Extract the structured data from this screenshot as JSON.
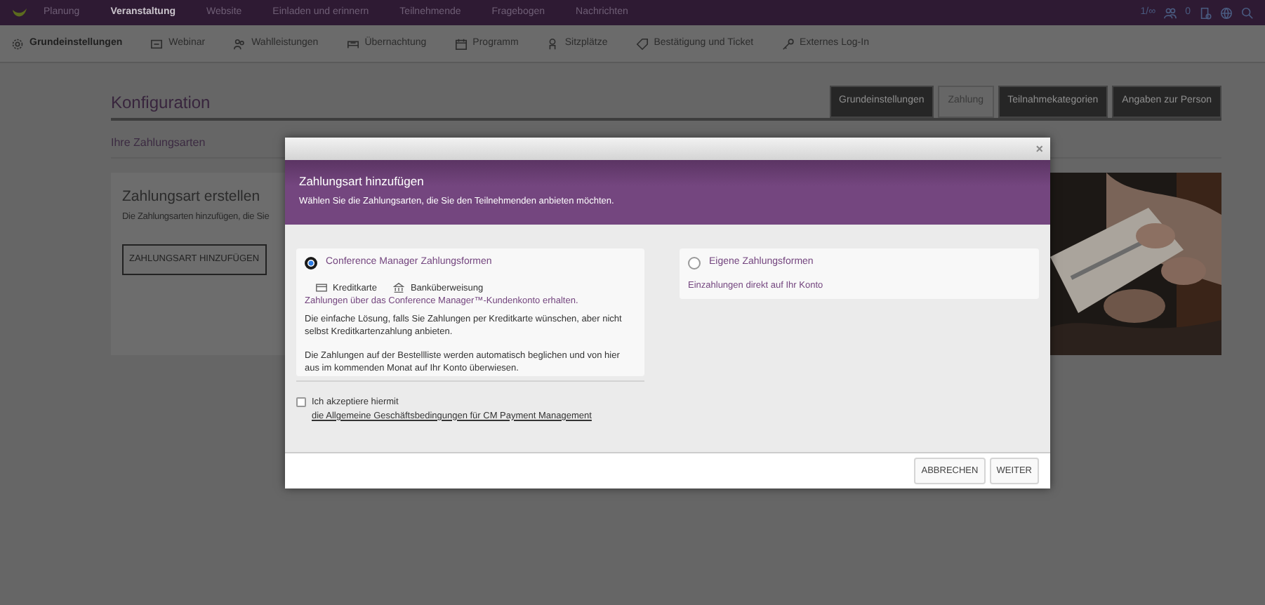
{
  "top_nav": {
    "items": [
      {
        "label": "Planung",
        "selected": false
      },
      {
        "label": "Veranstaltung",
        "selected": true
      },
      {
        "label": "Website",
        "selected": false
      },
      {
        "label": "Einladen und erinnern",
        "selected": false
      },
      {
        "label": "Teilnehmende",
        "selected": false
      },
      {
        "label": "Fragebogen",
        "selected": false
      },
      {
        "label": "Nachrichten",
        "selected": false
      }
    ],
    "counters": [
      "1/∞",
      "0"
    ]
  },
  "sub_nav": {
    "items": [
      {
        "label": "Grundeinstellungen",
        "selected": true
      },
      {
        "label": "Webinar",
        "selected": false
      },
      {
        "label": "Wahlleistungen",
        "selected": false
      },
      {
        "label": "Übernachtung",
        "selected": false
      },
      {
        "label": "Programm",
        "selected": false
      },
      {
        "label": "Sitzplätze",
        "selected": false
      },
      {
        "label": "Bestätigung und Ticket",
        "selected": false
      },
      {
        "label": "Externes Log-In",
        "selected": false
      }
    ]
  },
  "page": {
    "title": "Konfiguration",
    "tabs": [
      {
        "label": "Grundeinstellungen",
        "selected": false
      },
      {
        "label": "Zahlung",
        "selected": true
      },
      {
        "label": "Teilnahmekategorien",
        "selected": false
      },
      {
        "label": "Angaben zur Person",
        "selected": false
      }
    ],
    "section_title": "Ihre Zahlungsarten",
    "card": {
      "title": "Zahlungsart erstellen",
      "description": "Die Zahlungsarten hinzufügen, die Sie",
      "button": "ZAHLUNGSART HINZUFÜGEN"
    }
  },
  "modal": {
    "close": "×",
    "title": "Zahlungsart hinzufügen",
    "subtitle": "Wählen Sie die Zahlungsarten, die Sie den Teilnehmenden anbieten möchten.",
    "options": [
      {
        "title": "Conference Manager Zahlungsformen",
        "selected": true,
        "methods": [
          "Kreditkarte",
          "Banküberweisung"
        ],
        "subtitle": "Zahlungen über das Conference Manager™-Kundenkonto erhalten.",
        "paragraphs": [
          "Die einfache Lösung, falls Sie Zahlungen per Kreditkarte wünschen, aber nicht selbst Kreditkartenzahlung anbieten.",
          "Die Zahlungen auf der Bestellliste werden automatisch beglichen und von hier aus im kommenden Monat auf Ihr Konto überwiesen."
        ]
      },
      {
        "title": "Eigene Zahlungsformen",
        "selected": false,
        "subtitle": "Einzahlungen direkt auf Ihr Konto"
      }
    ],
    "terms": {
      "checked": false,
      "text": "Ich akzeptiere hiermit",
      "link": "die Allgemeine Geschäftsbedingungen für CM Payment Management"
    },
    "buttons": [
      "ABBRECHEN",
      "WEITER"
    ]
  }
}
